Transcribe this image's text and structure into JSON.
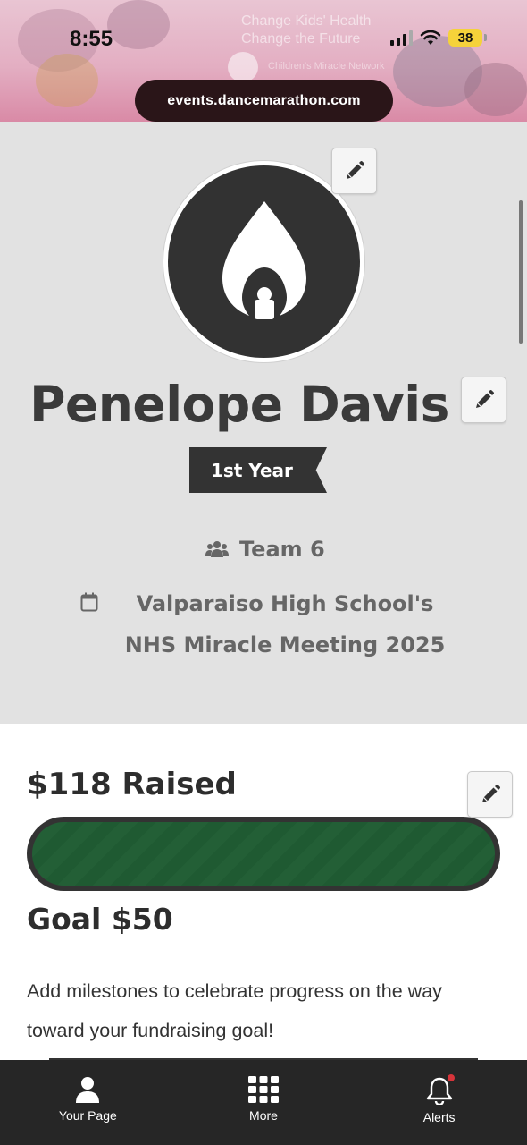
{
  "status_bar": {
    "time": "8:55",
    "battery": "38",
    "battery_color": "#f5d23a"
  },
  "banner": {
    "faded_text": "Change Kids' Health Change the Future",
    "faded_subtext": "Children's Miracle Network"
  },
  "browser": {
    "url": "events.dancemarathon.com"
  },
  "profile": {
    "name": "Penelope Davis",
    "year_badge": "1st Year",
    "team": "Team 6",
    "event": "Valparaiso High School's NHS Miracle Meeting 2025"
  },
  "fundraising": {
    "raised_label": "$118 Raised",
    "goal_label": "Goal $50",
    "progress_percent": 100,
    "progress_color": "#1f5a32",
    "milestones_text": "Add milestones to celebrate progress on the way toward your fundraising goal!"
  },
  "bottom_nav": {
    "items": [
      {
        "label": "Your Page",
        "icon": "user-icon"
      },
      {
        "label": "More",
        "icon": "grid-icon"
      },
      {
        "label": "Alerts",
        "icon": "bell-icon"
      }
    ]
  },
  "icons": {
    "edit": "pencil-icon",
    "team": "users-icon",
    "event": "calendar-icon",
    "avatar": "flame-logo-icon"
  }
}
